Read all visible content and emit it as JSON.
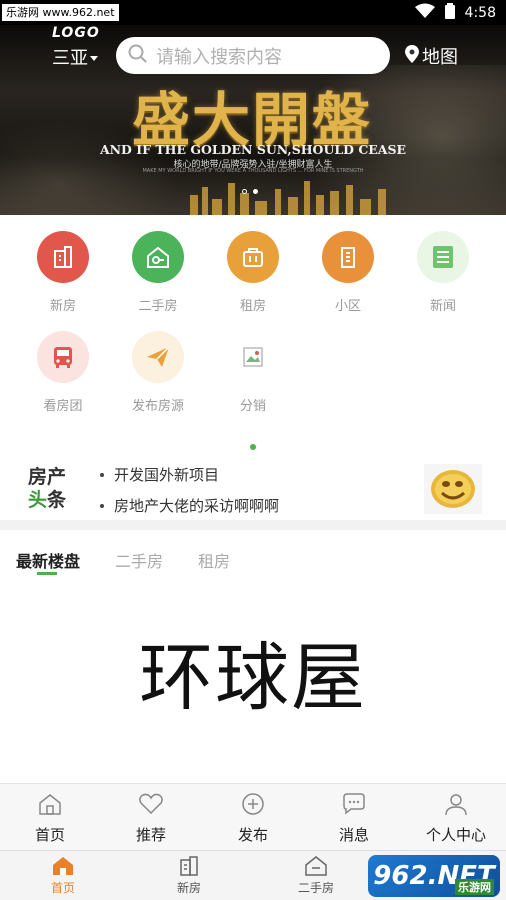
{
  "status_bar": {
    "watermark": "乐游网 www.962.net",
    "time": "4:58"
  },
  "banner": {
    "logo": "LOGO",
    "city": "三亚",
    "search_placeholder": "请输入搜索内容",
    "map_label": "地图",
    "headline": "盛大開盤",
    "tagline_en": "AND IF THE GOLDEN SUN,SHOULD CEASE",
    "tagline_cn": "核心的地带/品牌强势入驻/坐拥财富人生",
    "tagline_small": "MAKE MY WORLD BRIGHT IF YOU WERE A THOUSAND LIGHTS ... FOR MINE IS STRENGTH"
  },
  "menu": {
    "items": [
      {
        "label": "新房",
        "icon": "new-house-icon",
        "color": "#e2574c"
      },
      {
        "label": "二手房",
        "icon": "second-hand-house-icon",
        "color": "#4bb35a"
      },
      {
        "label": "租房",
        "icon": "rent-icon",
        "color": "#e8a13a"
      },
      {
        "label": "小区",
        "icon": "community-icon",
        "color": "#e8903a"
      },
      {
        "label": "新闻",
        "icon": "news-icon",
        "color": "#6cc46c"
      },
      {
        "label": "看房团",
        "icon": "bus-icon",
        "color": "#f6c8c2"
      },
      {
        "label": "发布房源",
        "icon": "paper-plane-icon",
        "color": "#fbe3c4"
      },
      {
        "label": "分销",
        "icon": "broken-image-icon",
        "color": "#ffffff"
      }
    ]
  },
  "news": {
    "logo_line1": "房产",
    "logo_line2a": "头",
    "logo_line2b": "条",
    "items": [
      "开发国外新项目",
      "房地产大佬的采访啊啊啊"
    ]
  },
  "tabs": {
    "items": [
      "最新楼盘",
      "二手房",
      "租房"
    ],
    "active": 0,
    "content_title": "环球屋"
  },
  "bottom_nav": {
    "items": [
      {
        "label": "首页",
        "icon": "home-icon"
      },
      {
        "label": "推荐",
        "icon": "heart-icon"
      },
      {
        "label": "发布",
        "icon": "plus-circle-icon"
      },
      {
        "label": "消息",
        "icon": "chat-icon"
      },
      {
        "label": "个人中心",
        "icon": "user-icon"
      }
    ]
  },
  "bottom_tabs": {
    "items": [
      {
        "label": "首页",
        "icon": "home-filled-icon"
      },
      {
        "label": "新房",
        "icon": "building-icon"
      },
      {
        "label": "二手房",
        "icon": "house-icon"
      }
    ],
    "active_color": "#e8812a"
  },
  "overlay_watermark": {
    "text": "962.NET",
    "sub": "乐游网"
  }
}
